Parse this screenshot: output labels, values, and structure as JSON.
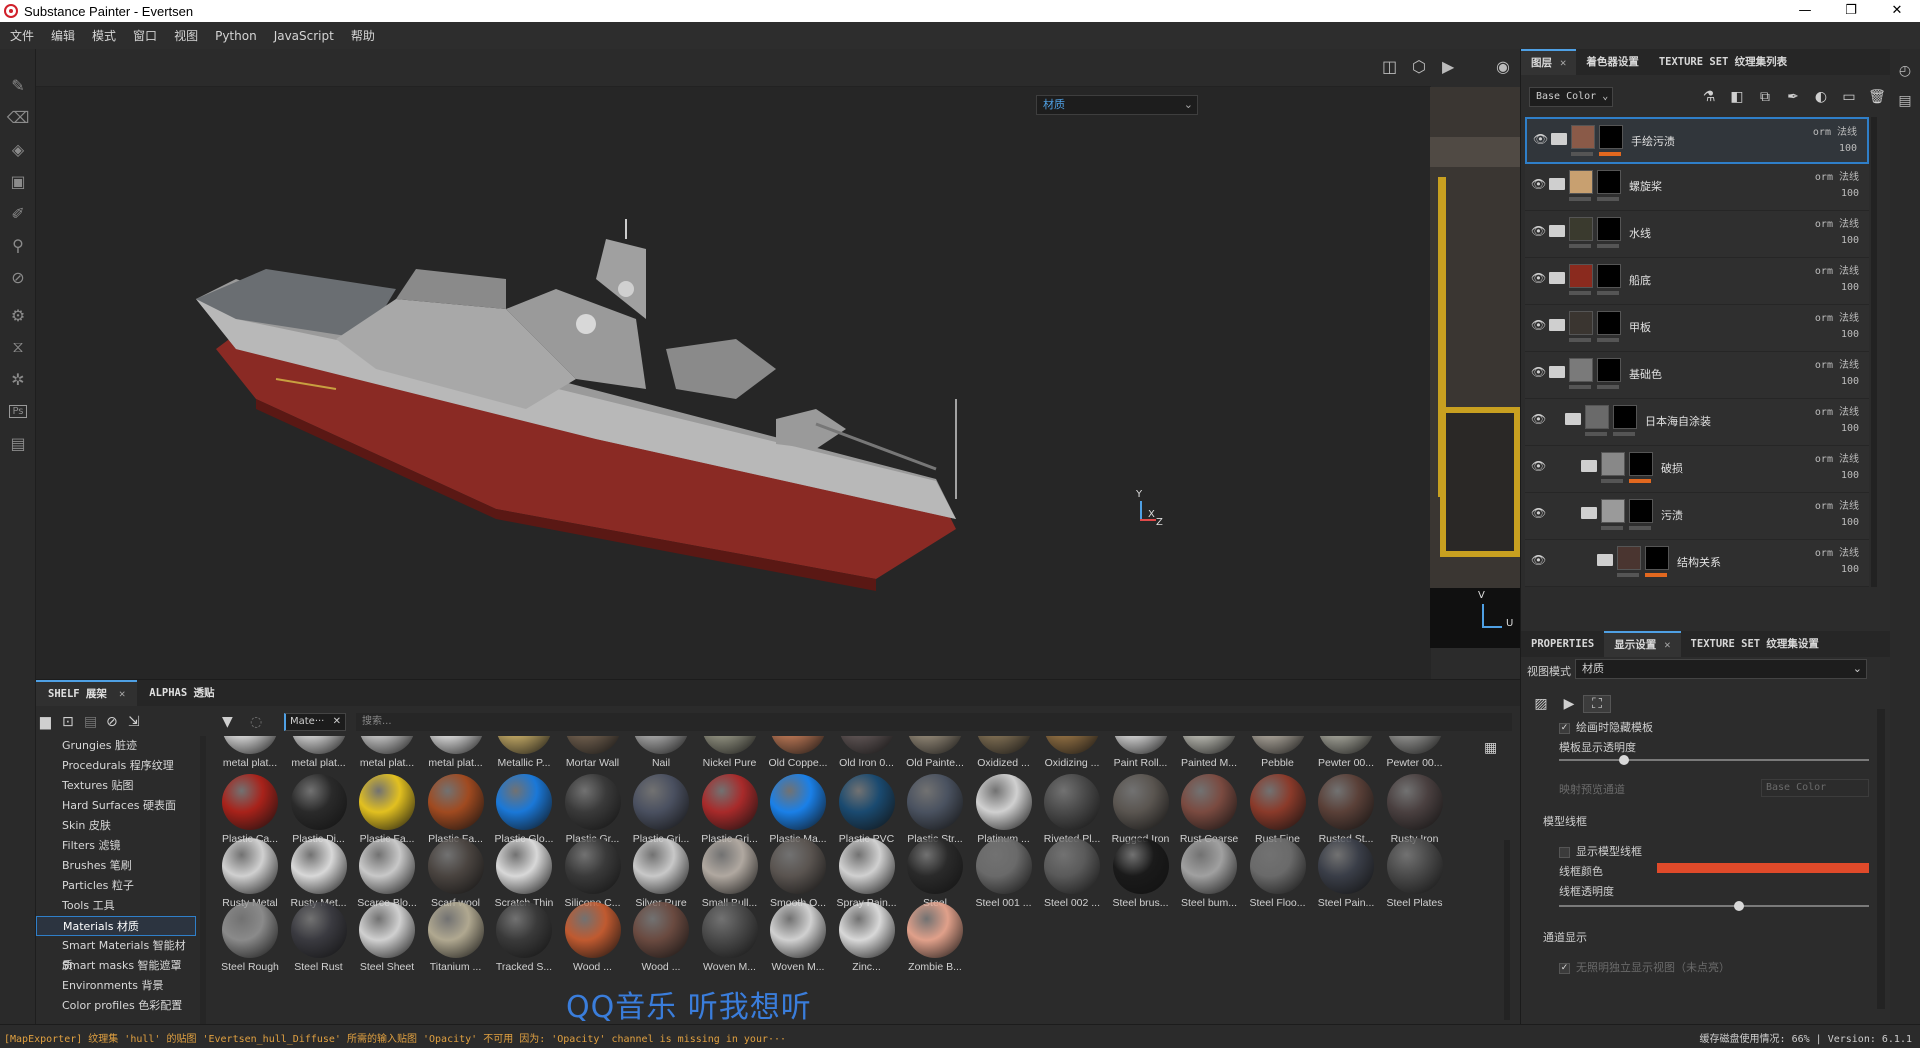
{
  "window": {
    "title": "Substance Painter - Evertsen",
    "controls": [
      "—",
      "❐",
      "✕"
    ]
  },
  "menu": [
    "文件",
    "编辑",
    "模式",
    "窗口",
    "视图",
    "Python",
    "JavaScript",
    "帮助"
  ],
  "viewport": {
    "material_select": "材质",
    "material_select2": "材质"
  },
  "layer_panel": {
    "tabs": [
      {
        "label": "图层",
        "active": true
      },
      {
        "label": "着色器设置"
      },
      {
        "label": "TEXTURE SET 纹理集列表"
      }
    ],
    "channel": "Base Color",
    "layers": [
      {
        "name": "手绘污渍",
        "blend": "orm 法线",
        "opacity": "100",
        "thumb": "#8a5a48",
        "selected": true,
        "orange": true,
        "indent": 0,
        "folder": true
      },
      {
        "name": "螺旋桨",
        "blend": "orm 法线",
        "opacity": "100",
        "thumb": "#c8a070",
        "indent": 0,
        "folder": true
      },
      {
        "name": "水线",
        "blend": "orm 法线",
        "opacity": "100",
        "thumb": "#3a3a2e",
        "indent": 0,
        "folder": true
      },
      {
        "name": "船底",
        "blend": "orm 法线",
        "opacity": "100",
        "thumb": "#8a2a1e",
        "indent": 0,
        "folder": true
      },
      {
        "name": "甲板",
        "blend": "orm 法线",
        "opacity": "100",
        "thumb": "#3a3530",
        "indent": 0,
        "folder": true
      },
      {
        "name": "基础色",
        "blend": "orm 法线",
        "opacity": "100",
        "thumb": "#7a7a7a",
        "indent": 0,
        "folder": true
      },
      {
        "name": "日本海自涂装",
        "blend": "orm 法线",
        "opacity": "100",
        "thumb": "#6a6a6a",
        "indent": 1,
        "folder": true
      },
      {
        "name": "破损",
        "blend": "orm 法线",
        "opacity": "100",
        "thumb": "#888888",
        "indent": 2,
        "orange": true,
        "folder": false
      },
      {
        "name": "污渍",
        "blend": "orm 法线",
        "opacity": "100",
        "thumb": "#9a9a9a",
        "indent": 2,
        "folder": true
      },
      {
        "name": "结构关系",
        "blend": "orm 法线",
        "opacity": "100",
        "thumb": "#4a3530",
        "indent": 3,
        "orange": true,
        "folder": true
      }
    ]
  },
  "props_panel": {
    "tabs": [
      {
        "label": "PROPERTIES"
      },
      {
        "label": "显示设置",
        "active": true
      },
      {
        "label": "TEXTURE SET 纹理集设置"
      }
    ],
    "view_mode_label": "视图模式",
    "view_mode_value": "材质",
    "hide_template_label": "绘画时隐藏模板",
    "template_opacity_label": "模板显示透明度",
    "template_opacity": 0.21,
    "channel_preview_label": "映射预览通道",
    "channel_preview_value": "Base Color",
    "wireframe_section": "模型线框",
    "show_wireframe_label": "显示模型线框",
    "wire_color_label": "线框颜色",
    "wire_color": "#e04a2a",
    "wire_opacity_label": "线框透明度",
    "wire_opacity": 0.58,
    "channel_display_section": "通道显示",
    "channel_display_item": "无照明独立显示视图（未点亮）"
  },
  "shelf": {
    "tabs": [
      {
        "label": "SHELF 展架",
        "active": true
      },
      {
        "label": "ALPHAS 透贴"
      }
    ],
    "filter_chip": "Mate···",
    "search_placeholder": "搜索...",
    "categories": [
      "Grungies 脏迹",
      "Procedurals 程序纹理",
      "Textures 贴图",
      "Hard Surfaces 硬表面",
      "Skin 皮肤",
      "Filters 滤镜",
      "Brushes 笔刷",
      "Particles 粒子",
      "Tools 工具",
      "Materials 材质",
      "Smart Materials 智能材质",
      "Smart masks 智能遮罩",
      "Environments 背景",
      "Color profiles 色彩配置"
    ],
    "selected_category": "Materials 材质",
    "materials_row0": [
      "metal plat...",
      "metal plat...",
      "metal plat...",
      "metal plat...",
      "Metallic P...",
      "Mortar Wall",
      "Nail",
      "Nickel Pure",
      "Old Coppe...",
      "Old Iron 0...",
      "Old Painte...",
      "Oxidized ...",
      "Oxidizing ...",
      "Paint Roll...",
      "Painted M...",
      "Pebble",
      "Pewter 00...",
      "Pewter 00..."
    ],
    "materials_row1": [
      "Plastic Ca...",
      "Plastic Di...",
      "Plastic Fa...",
      "Plastic Fa...",
      "Plastic Glo...",
      "Plastic Gr...",
      "Plastic Gri...",
      "Plastic Gri...",
      "Plastic Ma...",
      "Plastic PVC",
      "Plastic Str...",
      "Platinum ...",
      "Riveted Pl...",
      "Rugged Iron",
      "Rust Coarse",
      "Rust Fine",
      "Rusted St...",
      "Rusty Iron"
    ],
    "materials_row2": [
      "Rusty Metal",
      "Rusty Met...",
      "Scarce Blo...",
      "Scarf wool",
      "Scratch Thin",
      "Silicone C...",
      "Silver Pure",
      "Small Bull...",
      "Smooth O...",
      "Spray Pain...",
      "Steel",
      "Steel 001 ...",
      "Steel 002 ...",
      "Steel brus...",
      "Steel bum...",
      "Steel Floo...",
      "Steel Pain...",
      "Steel Plates"
    ],
    "materials_row3": [
      "Steel Rough",
      "Steel Rust",
      "Steel Sheet",
      "Titanium ...",
      "Tracked S...",
      "Wood ...",
      "Wood ...",
      "Woven M...",
      "Woven M...",
      "Zinc...",
      "Zombie B..."
    ],
    "colors_row0": [
      "#cfcfcf",
      "#c8c8c8",
      "#bdbdbd",
      "#d0d0d0",
      "#b8a060",
      "#6a5a4a",
      "#a0a0a0",
      "#8a8a7a",
      "#b07050",
      "#5a5050",
      "#8a8070",
      "#7a6a50",
      "#8a6a40",
      "#c8c8c8",
      "#b0b0a8",
      "#a09a90",
      "#9a9a90",
      "#8a8a88"
    ],
    "colors_row1": [
      "#a8221a",
      "#2a2a2a",
      "#e2c020",
      "#a04a20",
      "#1a78d8",
      "#3a3a3a",
      "#4a5060",
      "#a82a2a",
      "#1a80e8",
      "#1a4a70",
      "#4a5260",
      "#d0d0d0",
      "#4a4a4a",
      "#5a5550",
      "#7a4a40",
      "#8a3a2a",
      "#5a4038",
      "#4a4040"
    ],
    "colors_row2": [
      "#d0d0d0",
      "#d8d8d8",
      "#c8c8c8",
      "#4a4440",
      "#d8d8d8",
      "#3a3a3a",
      "#c8c8c8",
      "#b0a8a0",
      "#5a5450",
      "#d0d0d0",
      "#2a2a2a",
      "#6a6a6a",
      "#5a5a5a",
      "#1a1a1a",
      "#a0a0a0",
      "#6a6a6a",
      "#3a3e48",
      "#4a4a4a"
    ],
    "colors_row3": [
      "#8a8a8a",
      "#3a3a40",
      "#d0d0d0",
      "#b0a890",
      "#3a3a3a",
      "#c05a30",
      "#6a4a40",
      "#4a4a4a",
      "#d0d0d0",
      "#d8d8d8",
      "#e0a08a"
    ]
  },
  "status": {
    "message": "[MapExporter] 纹理集 'hull' 的贴图 'Evertsen_hull_Diffuse' 所需的输入贴图 'Opacity' 不可用 因为: 'Opacity' channel is missing in your···",
    "disk": "缓存磁盘使用情况:  66%",
    "version": "Version: 6.1.1"
  },
  "overlay_watermark": "QQ音乐 听我想听",
  "axis_labels": {
    "y": "Y",
    "x": "X",
    "z": "Z",
    "v": "V",
    "u": "U"
  }
}
